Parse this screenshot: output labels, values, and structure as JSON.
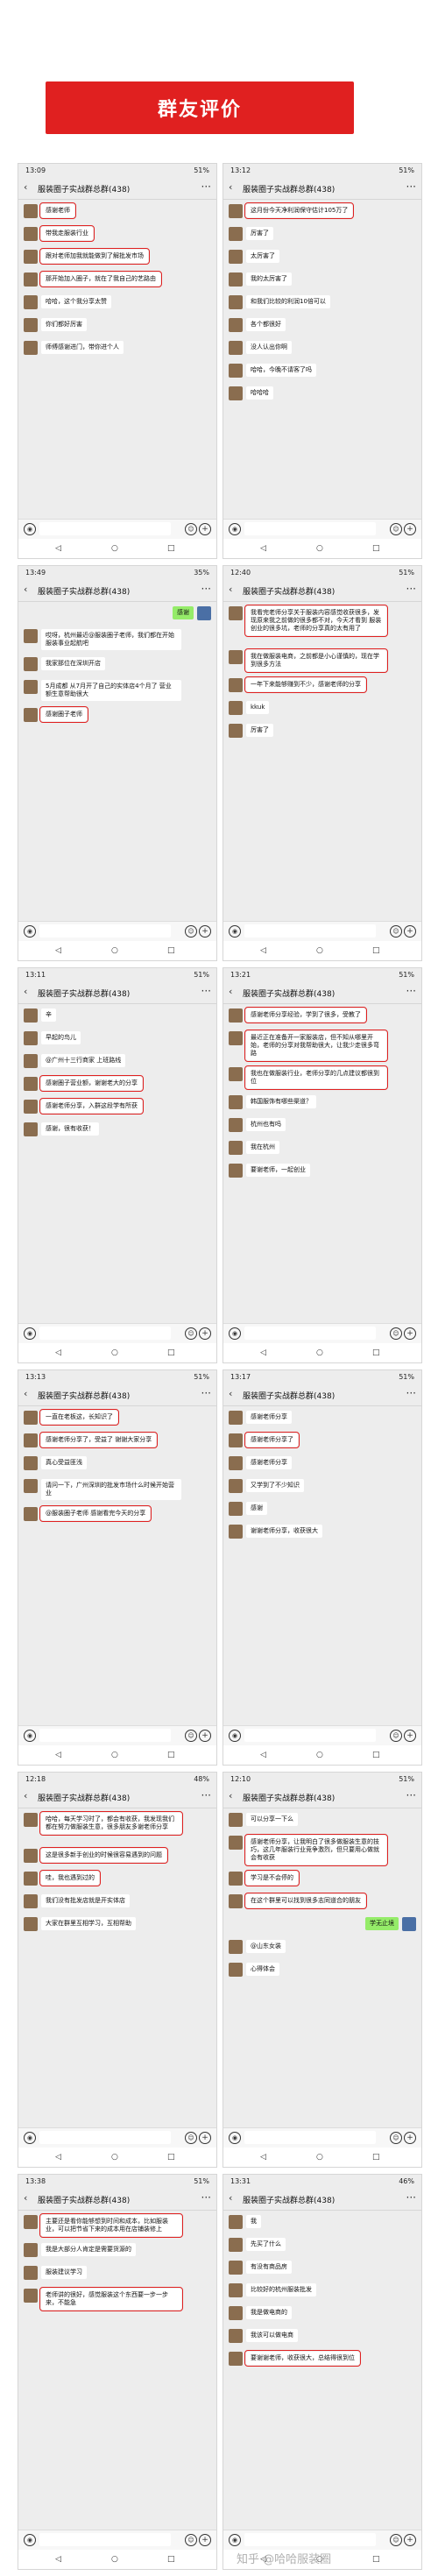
{
  "banner": {
    "title": "群友评价"
  },
  "group_title": "服装圈子实战群总群(438)",
  "screens": [
    {
      "id": "s1",
      "time": "13:09",
      "battery": "51%",
      "messages": [
        {
          "d": "in",
          "t": "感谢老师",
          "box": true
        },
        {
          "d": "in",
          "t": "带我走服装行业",
          "box": true
        },
        {
          "d": "in",
          "t": "跟对老师加我就能做到了解批发市场",
          "box": true
        },
        {
          "d": "in",
          "t": "那开始加入圈子，就在了我自己的艺路由",
          "box": true
        },
        {
          "d": "in",
          "t": "哈哈，这个我分享太赞"
        },
        {
          "d": "in",
          "t": "你们都好厉害"
        },
        {
          "d": "in",
          "t": "师傅感谢进门，带你进个人"
        }
      ]
    },
    {
      "id": "s2",
      "time": "13:12",
      "battery": "51%",
      "messages": [
        {
          "d": "in",
          "t": "这月份今天净利润保守估计105万了",
          "box": true
        },
        {
          "d": "in",
          "t": "厉害了"
        },
        {
          "d": "in",
          "t": "太厉害了"
        },
        {
          "d": "in",
          "t": "我的太厉害了"
        },
        {
          "d": "in",
          "t": "和我们比较的利润10倍可以"
        },
        {
          "d": "in",
          "t": "各个都很好"
        },
        {
          "d": "in",
          "t": "没人认出你啊"
        },
        {
          "d": "in",
          "t": "哈哈，今晚不请客了吗"
        },
        {
          "d": "in",
          "t": "哈哈哈"
        }
      ]
    },
    {
      "id": "s3",
      "time": "13:49",
      "battery": "35%",
      "messages": [
        {
          "d": "out",
          "t": "感谢"
        },
        {
          "d": "in",
          "t": "哎呀，杭州最近@服装圈子老师，我们都在开始服装事业起航吧"
        },
        {
          "d": "in",
          "t": "我家那位在深圳开店"
        },
        {
          "d": "in",
          "t": "5月成都 从7月开了自己的实体店4个月了 营业额生意帮助很大"
        },
        {
          "d": "in",
          "t": "感谢圈子老师",
          "box": true
        }
      ]
    },
    {
      "id": "s4",
      "time": "12:40",
      "battery": "51%",
      "messages": [
        {
          "d": "in",
          "t": "我看完老师分享关于服装内容感觉收获很多，发现原来我之前做的很多都不对，今天才看到 服装创业的很多坑，老师的分享真的太有用了",
          "box": true
        },
        {
          "d": "in",
          "t": "我在做服装电商，之前都是小心谨慎的，现在学到很多方法",
          "box": true
        },
        {
          "d": "in",
          "t": "一年下来能够赚到不少，感谢老师的分享",
          "box": true
        },
        {
          "d": "in",
          "t": "kkuk"
        },
        {
          "d": "in",
          "t": "厉害了"
        }
      ]
    },
    {
      "id": "s5",
      "time": "13:11",
      "battery": "51%",
      "messages": [
        {
          "d": "in",
          "t": "辛"
        },
        {
          "d": "in",
          "t": "早起的鸟儿"
        },
        {
          "d": "in",
          "t": "@广州十三行商家 上班路线"
        },
        {
          "d": "in",
          "t": "感谢圈子营业额，谢谢老大的分享",
          "box": true
        },
        {
          "d": "in",
          "t": "感谢老师分享，入群这段学有所获",
          "box": true
        },
        {
          "d": "in",
          "t": "感谢，很有收获！"
        }
      ]
    },
    {
      "id": "s6",
      "time": "13:21",
      "battery": "51%",
      "messages": [
        {
          "d": "in",
          "t": "感谢老师分享经验，学到了很多，受教了",
          "box": true
        },
        {
          "d": "in",
          "t": "最近正在准备开一家服装店，但不知从哪里开始，老师的分享对我帮助很大，让我少走很多弯路",
          "box": true
        },
        {
          "d": "in",
          "t": "我也在做服装行业，老师分享的几点建议都很到位",
          "box": true
        },
        {
          "d": "in",
          "t": "韩国服饰有哪些渠道？"
        },
        {
          "d": "in",
          "t": "杭州也有吗"
        },
        {
          "d": "in",
          "t": "我在杭州"
        },
        {
          "d": "in",
          "t": "要谢老师，一起创业"
        }
      ]
    },
    {
      "id": "s7",
      "time": "13:13",
      "battery": "51%",
      "messages": [
        {
          "d": "in",
          "t": "一直在老板这，长知识了",
          "box": true
        },
        {
          "d": "in",
          "t": "感谢老师分享了，受益了 谢谢大家分享",
          "box": true
        },
        {
          "d": "in",
          "t": "真心受益匪浅"
        },
        {
          "d": "in",
          "t": "请问一下，广州深圳的批发市场什么时候开始营业"
        },
        {
          "d": "in",
          "t": "@服装圈子老师 感谢看完今天的分享",
          "box": true
        }
      ]
    },
    {
      "id": "s8",
      "time": "13:17",
      "battery": "51%",
      "messages": [
        {
          "d": "in",
          "t": "感谢老师分享"
        },
        {
          "d": "in",
          "t": "感谢老师分享了",
          "box": true
        },
        {
          "d": "in",
          "t": "感谢老师分享"
        },
        {
          "d": "in",
          "t": "又学到了不少知识"
        },
        {
          "d": "in",
          "t": "感谢"
        },
        {
          "d": "in",
          "t": "谢谢老师分享，收获很大"
        }
      ]
    },
    {
      "id": "s9",
      "time": "12:18",
      "battery": "48%",
      "messages": [
        {
          "d": "in",
          "t": "哈哈，每天学习时了，都会有收获，我发现我们都在努力做服装生意，很多朋友多谢老师分享",
          "box": true
        },
        {
          "d": "in",
          "t": "这是很多新手创业的时候很容易遇到的问题",
          "box": true
        },
        {
          "d": "in",
          "t": "哇，我也遇到过的",
          "box": true
        },
        {
          "d": "in",
          "t": "我们没有批发店就是开实体店"
        },
        {
          "d": "in",
          "t": "大家在群里互相学习，互相帮助"
        }
      ]
    },
    {
      "id": "s10",
      "time": "12:10",
      "battery": "51%",
      "messages": [
        {
          "d": "in",
          "t": "可以分享一下么"
        },
        {
          "d": "in",
          "t": "感谢老师分享，让我明白了很多做服装生意的技巧，这几年服装行业竞争激烈，但只要用心做就会有收获",
          "box": true
        },
        {
          "d": "in",
          "t": "学习是不会停的",
          "box": true
        },
        {
          "d": "in",
          "t": "在这个群里可以找到很多志同道合的朋友",
          "box": true
        },
        {
          "d": "out",
          "t": "学无止境"
        },
        {
          "d": "in",
          "t": "@山东女装"
        },
        {
          "d": "in",
          "t": "心得体会"
        }
      ]
    },
    {
      "id": "s11",
      "time": "13:38",
      "battery": "51%",
      "messages": [
        {
          "d": "in",
          "t": "主要还是看你能够想到时间和成本，比如服装业，可以把节省下来的成本用在店铺装修上",
          "box": true
        },
        {
          "d": "in",
          "t": "我是大部分人肯定是需要货源的"
        },
        {
          "d": "in",
          "t": "服装建议学习"
        },
        {
          "d": "in",
          "t": "老师讲的很好，感觉服装这个东西要一步一步来，不能急",
          "box": true
        }
      ]
    },
    {
      "id": "s12",
      "time": "13:31",
      "battery": "46%",
      "messages": [
        {
          "d": "in",
          "t": "我"
        },
        {
          "d": "in",
          "t": "先买了什么"
        },
        {
          "d": "in",
          "t": "有没有商品房"
        },
        {
          "d": "in",
          "t": "比较好的杭州服装批发"
        },
        {
          "d": "in",
          "t": "我是做电商的"
        },
        {
          "d": "in",
          "t": "我该可以做电商"
        },
        {
          "d": "in",
          "t": "要谢谢老师，收获很大，总结得很到位",
          "box": true
        }
      ]
    }
  ],
  "icons": {
    "back": "chevron-left-icon",
    "more": "ellipsis-icon",
    "voice": "voice-icon",
    "emoji": "emoji-icon",
    "plus": "plus-icon"
  },
  "watermark": "知乎 @哈哈服装圈"
}
